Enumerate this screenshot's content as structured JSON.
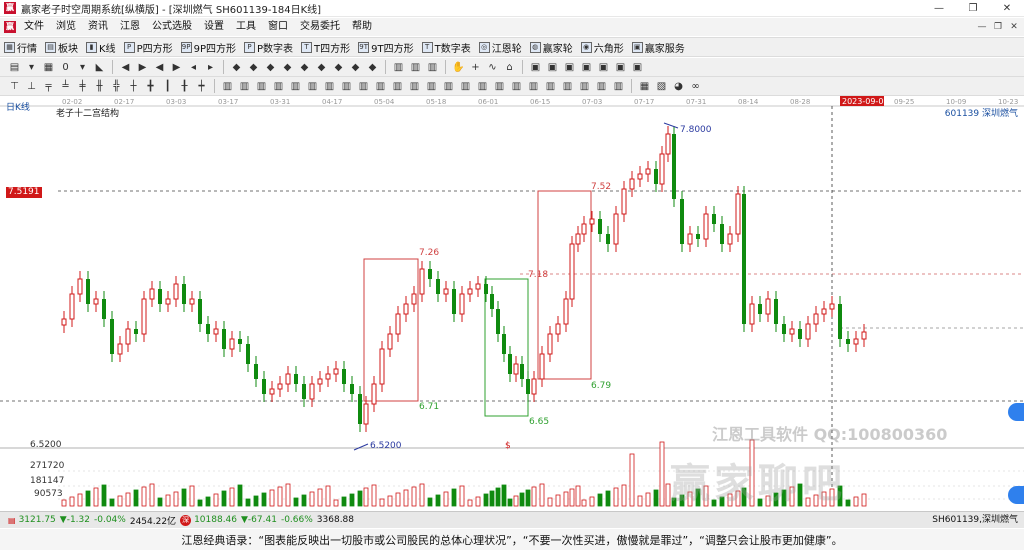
{
  "window": {
    "title": "赢家老子时空周期系统[纵横版] - [深圳燃气  SH601139-184日K线]",
    "app_icon": "赢",
    "minimize": "—",
    "restore": "❐",
    "close": "✕"
  },
  "menu": [
    "文件",
    "浏览",
    "资讯",
    "江恩",
    "公式选股",
    "设置",
    "工具",
    "窗口",
    "交易委托",
    "帮助"
  ],
  "mdi": {
    "minimize": "—",
    "restore": "❐",
    "close": "✕"
  },
  "toolbar1": [
    {
      "label": "行情",
      "icon": "grid-icon"
    },
    {
      "label": "板块",
      "icon": "blocks-icon"
    },
    {
      "label": "K线",
      "icon": "candles-icon"
    },
    {
      "label": "P四方形",
      "icon": "p-square-icon"
    },
    {
      "label": "9P四方形",
      "icon": "9p-square-icon"
    },
    {
      "label": "P数字表",
      "icon": "p-table-icon"
    },
    {
      "label": "T四方形",
      "icon": "t-square-icon"
    },
    {
      "label": "9T四方形",
      "icon": "9t-square-icon"
    },
    {
      "label": "T数字表",
      "icon": "t-table-icon"
    },
    {
      "label": "江恩轮",
      "icon": "gann-wheel-icon"
    },
    {
      "label": "赢家轮",
      "icon": "winner-wheel-icon"
    },
    {
      "label": "六角形",
      "icon": "hexagon-icon"
    },
    {
      "label": "赢家服务",
      "icon": "service-icon"
    }
  ],
  "chart": {
    "timeframe": "日K线",
    "title": "老子十二宫结构",
    "stock": "601139  深圳燃气",
    "current_price_tag": "7.5191",
    "left_price_label": "6.5200",
    "date_labels": [
      "02-02",
      "02-17",
      "03-03",
      "03-17",
      "03-31",
      "04-17",
      "05-04",
      "05-18",
      "06-01",
      "06-15",
      "07-03",
      "07-17",
      "07-31",
      "08-14",
      "08-28",
      "2023-09-06",
      "09-25",
      "10-09",
      "10-23"
    ],
    "volume_labels": [
      "271720",
      "181147",
      "90573"
    ],
    "annotations": {
      "high": "7.8000",
      "low": "6.5200",
      "a1": "7.26",
      "a2": "6.71",
      "a3": "7.18",
      "a4": "6.65",
      "a5": "7.52",
      "a6": "6.79",
      "marker": "$"
    },
    "watermark_line1": "江恩工具软件  QQ:100800360",
    "watermark_line2": "赢家聊吧",
    "colors": {
      "up": "#d01818",
      "down": "#0f8a0f",
      "grid": "#333333",
      "box_red": "#d04040",
      "box_green": "#2fa02f"
    }
  },
  "chart_data": {
    "type": "candlestick",
    "price_range": [
      6.4,
      7.9
    ],
    "y_ticks": [
      6.52,
      7.5191
    ],
    "annotated_high": 7.8,
    "annotated_low": 6.52
  },
  "statusbar": {
    "sh_index": "3121.75",
    "sh_change": "▼-1.32",
    "sh_pct": "-0.04%",
    "sh_amount": "2454.22亿",
    "sz_badge": "深",
    "sz_index": "10188.46",
    "sz_change": "▼-67.41",
    "sz_pct": "-0.66%",
    "sz_amount": "3368.88",
    "current": "SH601139,深圳燃气"
  },
  "quote": "江恩经典语录：“图表能反映出一切股市或公司股民的总体心理状况”，“不要一次性买进，傲慢就是罪过”，“调整只会让股市更加健康”。"
}
